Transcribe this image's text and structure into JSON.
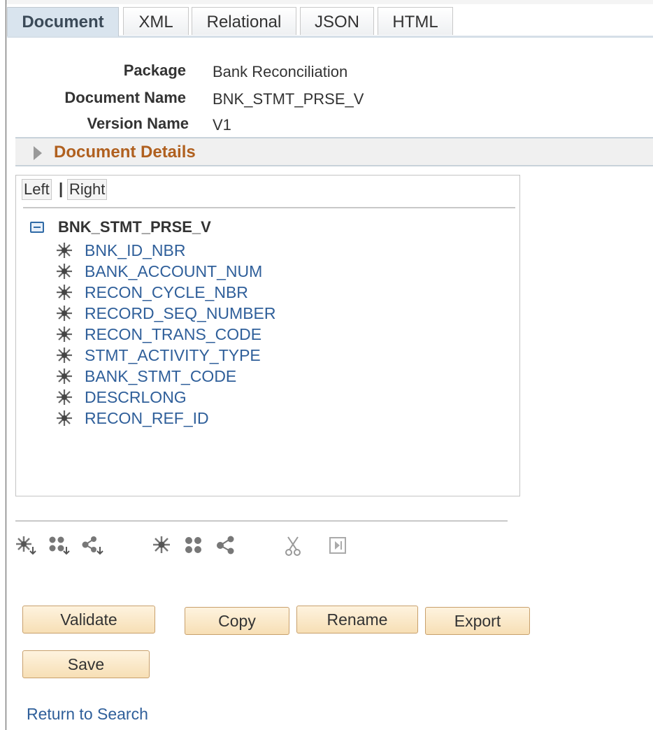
{
  "tabs": [
    {
      "label": "Document",
      "active": true
    },
    {
      "label": "XML"
    },
    {
      "label": "Relational"
    },
    {
      "label": "JSON"
    },
    {
      "label": "HTML"
    }
  ],
  "header": {
    "package_label": "Package",
    "package_value": "Bank Reconciliation",
    "docname_label": "Document Name",
    "docname_value": "BNK_STMT_PRSE_V",
    "version_label": "Version Name",
    "version_value": "V1"
  },
  "details": {
    "title": "Document Details"
  },
  "tree": {
    "left_label": "Left",
    "separator": "|",
    "right_label": "Right",
    "root": "BNK_STMT_PRSE_V",
    "items": [
      "BNK_ID_NBR",
      "BANK_ACCOUNT_NUM",
      "RECON_CYCLE_NBR",
      "RECORD_SEQ_NUMBER",
      "RECON_TRANS_CODE",
      "STMT_ACTIVITY_TYPE",
      "BANK_STMT_CODE",
      "DESCRLONG",
      "RECON_REF_ID"
    ]
  },
  "toolbar_icons": [
    "add-child-element-icon",
    "add-child-collection-icon",
    "add-child-compound-icon",
    "add-sibling-element-icon",
    "add-sibling-collection-icon",
    "add-sibling-compound-icon",
    "cut-icon",
    "paste-icon"
  ],
  "buttons": {
    "validate": "Validate",
    "copy": "Copy",
    "rename": "Rename",
    "export": "Export",
    "save": "Save"
  },
  "links": {
    "return_search": "Return to Search"
  }
}
